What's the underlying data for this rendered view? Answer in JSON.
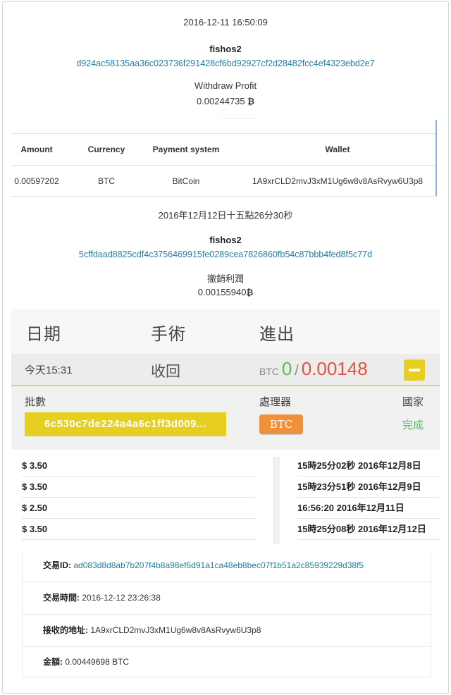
{
  "withdraw_1": {
    "datetime": "2016-12-11 16:50:09",
    "user": "fishos2",
    "hash": "d924ac58135aa36c023736f291428cf6bd92927cf2d28482fcc4ef4323ebd2e7",
    "label": "Withdraw Profit",
    "amount": "0.00244735",
    "symbol": "₿"
  },
  "payment_table": {
    "headers": [
      "Amount",
      "Currency",
      "Payment system",
      "Wallet"
    ],
    "row": [
      "0.00597202",
      "BTC",
      "BitCoin",
      "1A9xrCLD2mvJ3xM1Ug6w8v8AsRvyw6U3p8"
    ]
  },
  "withdraw_2": {
    "datetime": "2016年12月12日十五點26分30秒",
    "user": "fishos2",
    "hash": "5cffdaad8825cdf4c3756469915fe0289cea7826860fb54c87bbb4fed8f5c77d",
    "label": "撤銷利潤",
    "amount": "0.00155940",
    "symbol": "₿"
  },
  "panel": {
    "headers": [
      "日期",
      "手術",
      "進出"
    ],
    "time": "今天15:31",
    "action": "收回",
    "btc_prefix": "BTC",
    "in_value": "0",
    "separator": "/",
    "out_value": "0.00148",
    "batch_label": "批數",
    "processor_label": "處理器",
    "country_label": "國家",
    "batch_hash": "6c530c7de224a4a6c1ff3d009...",
    "processor": "BTC",
    "status": "完成"
  },
  "prices": [
    "$ 3.50",
    "$ 3.50",
    "$ 2.50",
    "$ 3.50"
  ],
  "times": [
    "15時25分02秒 2016年12月8日",
    "15時23分51秒 2016年12月9日",
    "16:56:20 2016年12月11日",
    "15時25分08秒 2016年12月12日"
  ],
  "transaction": {
    "id_label": "交易ID:",
    "id_value": "ad083d8d8ab7b207f4b8a98ef6d91a1ca48eb8bec07f1b51a2c85939229d38f5",
    "time_label": "交易時間:",
    "time_value": "2016-12-12 23:26:38",
    "address_label": "接收的地址:",
    "address_value": "1A9xrCLD2mvJ3xM1Ug6w8v8AsRvyw6U3p8",
    "amount_label": "金額:",
    "amount_value": "0.00449698 BTC"
  },
  "colors": {
    "accent_yellow": "#e6cf1f",
    "link_blue": "#1f7fa6",
    "green": "#5cb85c",
    "red": "#e0533f",
    "orange": "#f0903a"
  }
}
